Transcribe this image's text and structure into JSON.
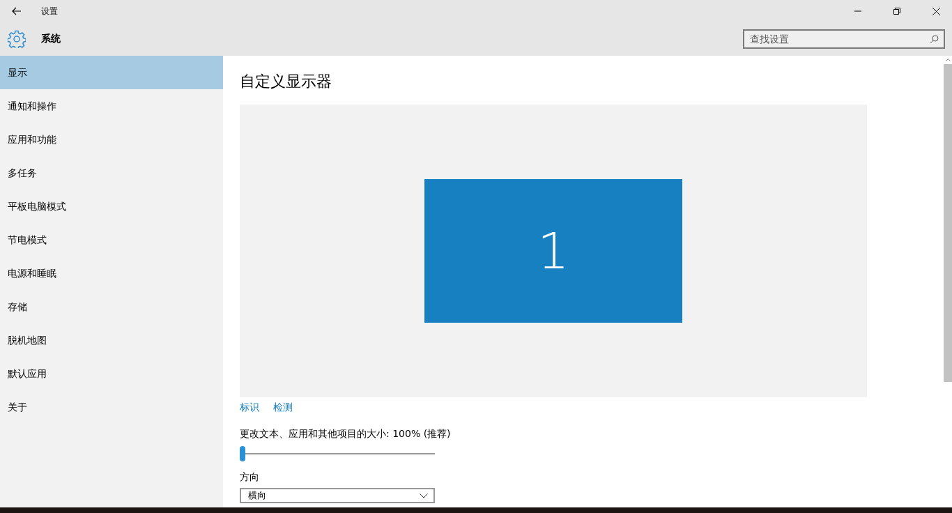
{
  "window": {
    "title": "设置"
  },
  "header": {
    "title": "系统",
    "search": {
      "placeholder": "查找设置"
    }
  },
  "sidebar": {
    "items": [
      {
        "label": "显示",
        "selected": true
      },
      {
        "label": "通知和操作",
        "selected": false
      },
      {
        "label": "应用和功能",
        "selected": false
      },
      {
        "label": "多任务",
        "selected": false
      },
      {
        "label": "平板电脑模式",
        "selected": false
      },
      {
        "label": "节电模式",
        "selected": false
      },
      {
        "label": "电源和睡眠",
        "selected": false
      },
      {
        "label": "存储",
        "selected": false
      },
      {
        "label": "脱机地图",
        "selected": false
      },
      {
        "label": "默认应用",
        "selected": false
      },
      {
        "label": "关于",
        "selected": false
      }
    ]
  },
  "content": {
    "heading": "自定义显示器",
    "monitor": {
      "number": "1"
    },
    "links": [
      "标识",
      "检测"
    ],
    "scale": {
      "label": "更改文本、应用和其他项目的大小: 100% (推荐)",
      "level": 0
    },
    "orientation": {
      "label": "方向",
      "value": "横向"
    }
  }
}
